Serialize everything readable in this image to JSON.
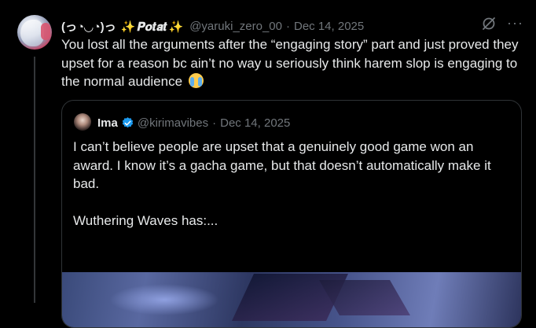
{
  "tweet": {
    "display_name_prefix": "(っ◔◡◔)っ",
    "display_name_core": "𝑷𝒐𝒕𝒂𝒕",
    "sparkle": "✨",
    "handle": "@yaruki_zero_00",
    "separator": "·",
    "time": "Dec 14, 2025",
    "more_label": "···",
    "text": "You lost all the arguments after the “engaging story” part and just proved they upset for a reason bc ain’t no way u seriously think harem slop is engaging to the normal audience",
    "emoji": "crying-face"
  },
  "quote": {
    "display_name": "Ima",
    "handle": "@kirimavibes",
    "separator": "·",
    "time": "Dec 14, 2025",
    "verified_color": "#1d9bf0",
    "paragraph1": "I can’t believe people are upset that a genuinely good game won an award. I know it’s a gacha game, but that doesn’t automatically make it bad.",
    "paragraph2": "Wuthering Waves has:..."
  },
  "colors": {
    "background": "#000000",
    "text": "#e7e9ea",
    "muted": "#71767b",
    "border": "#2f3336"
  }
}
